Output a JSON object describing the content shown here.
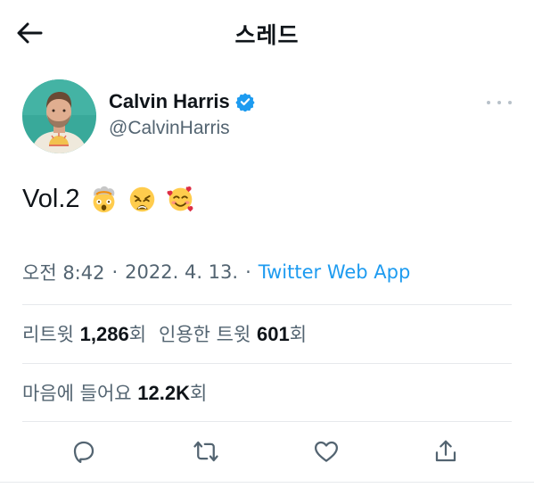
{
  "header": {
    "title": "스레드",
    "back_icon": "arrow-left-icon"
  },
  "author": {
    "display_name": "Calvin Harris",
    "handle": "@CalvinHarris",
    "verified": true,
    "verified_color": "#1d9bf0"
  },
  "tweet": {
    "text": "Vol.2",
    "emojis": [
      "exploding-head-emoji",
      "weary-face-emoji",
      "smiling-face-with-hearts-emoji"
    ]
  },
  "meta": {
    "time": "오전 8:42",
    "sep": "·",
    "date": "2022. 4. 13.",
    "source": "Twitter Web App"
  },
  "stats": {
    "retweets_label": "리트윗",
    "retweets_count": "1,286",
    "retweets_unit": "회",
    "quotes_label": "인용한 트윗",
    "quotes_count": "601",
    "quotes_unit": "회",
    "likes_label": "마음에 들어요",
    "likes_count": "12.2K",
    "likes_unit": "회"
  },
  "actions": [
    "reply-icon",
    "retweet-icon",
    "like-icon",
    "share-icon"
  ],
  "colors": {
    "text_primary": "#0f1419",
    "text_secondary": "#536471",
    "link": "#1d9bf0",
    "divider": "#e6e9ec"
  }
}
